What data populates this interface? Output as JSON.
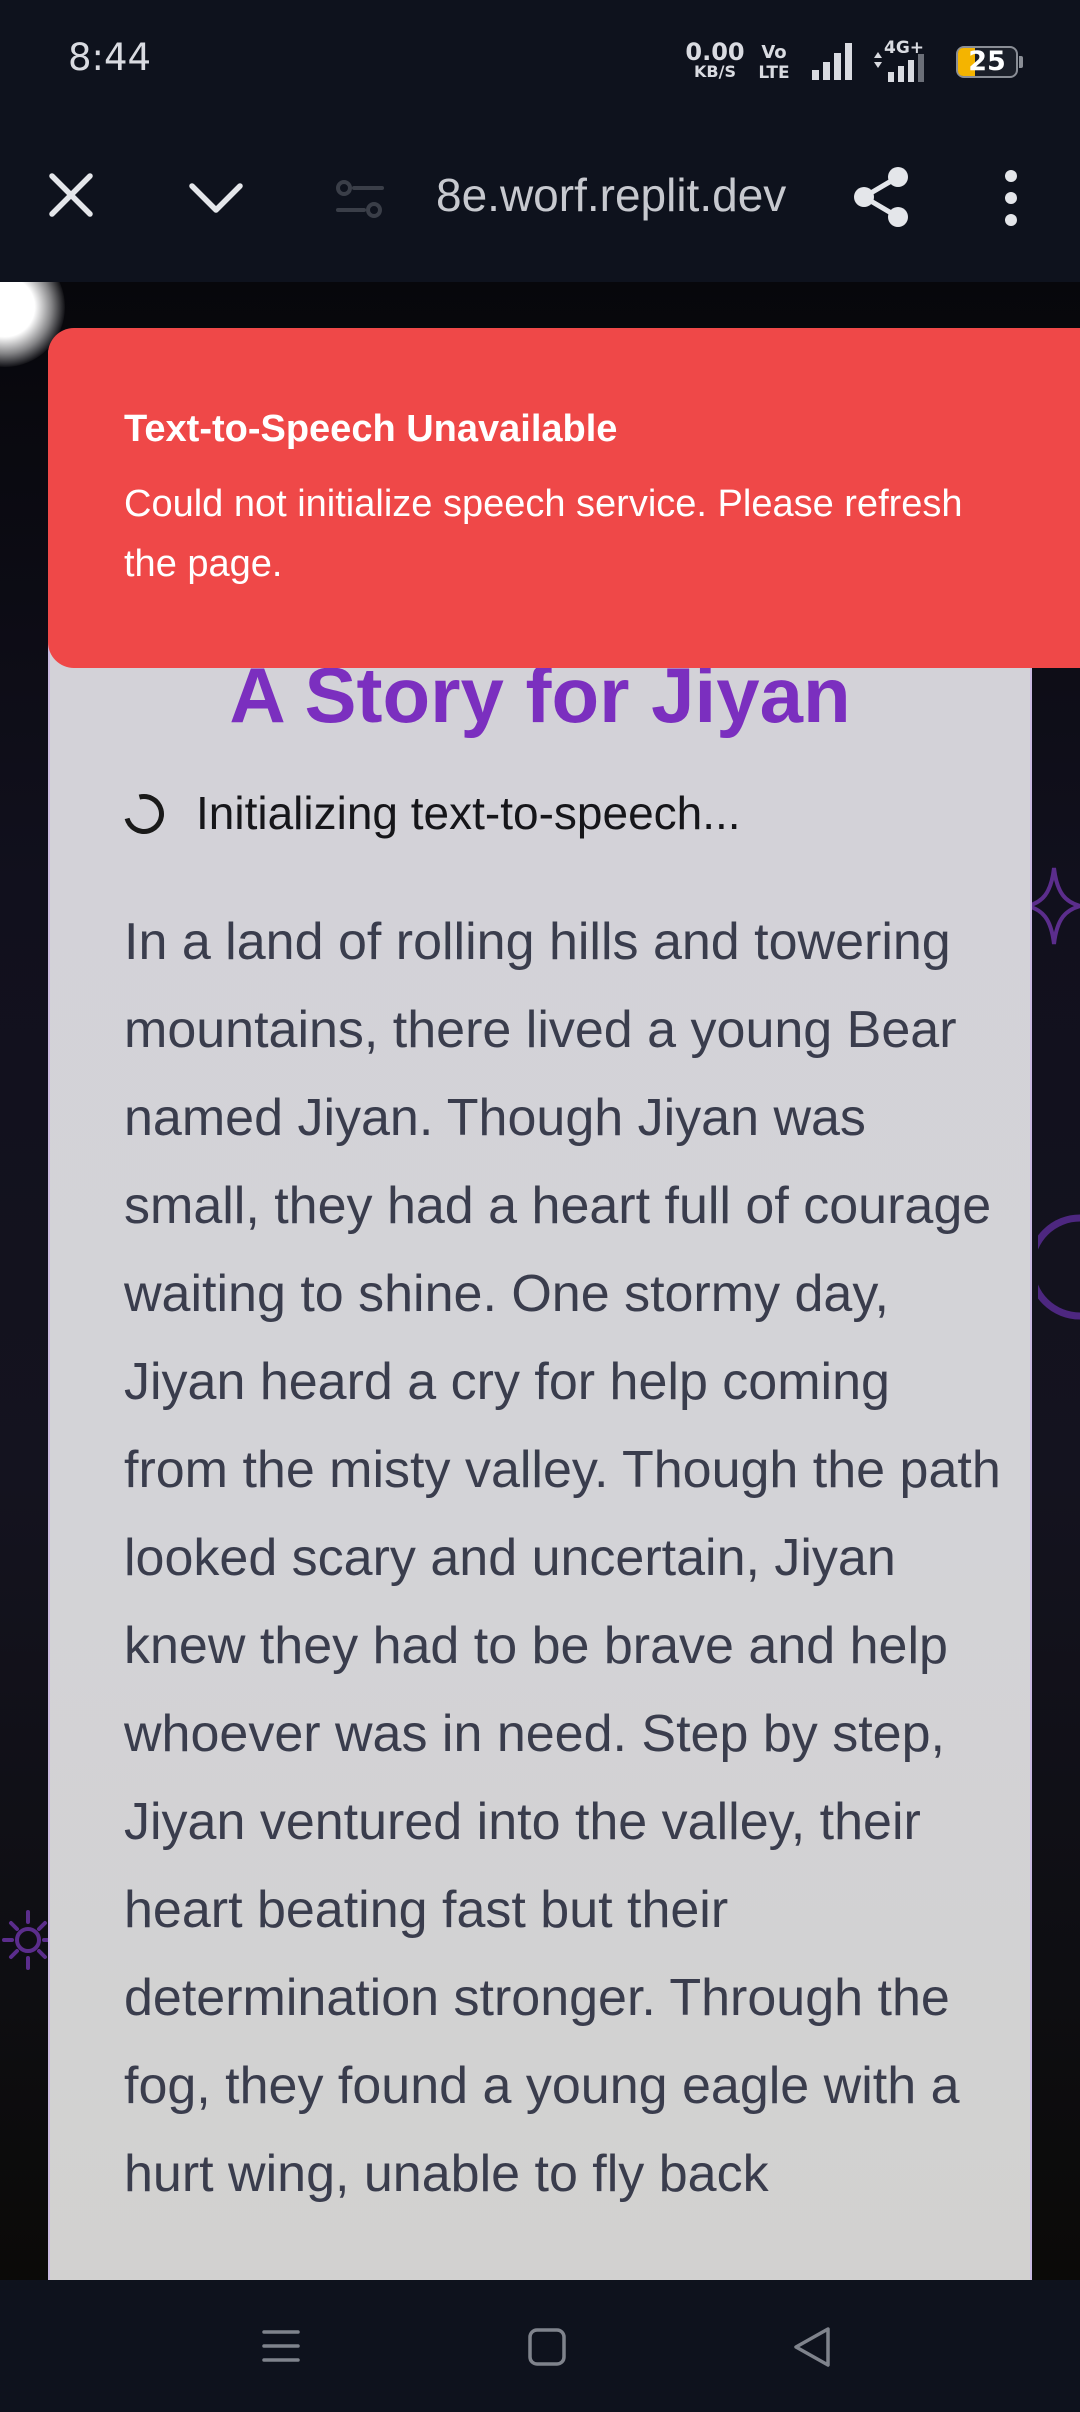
{
  "status_bar": {
    "time": "8:44",
    "net_speed_value": "0.00",
    "net_speed_unit": "KB/S",
    "volte_line1": "Vo",
    "volte_line2": "LTE",
    "network_type": "4G+",
    "battery_level": "25"
  },
  "browser": {
    "url": "8e.worf.replit.dev",
    "icons": [
      "close-icon",
      "chevron-down-icon",
      "page-settings-icon",
      "share-icon",
      "more-vert-icon"
    ]
  },
  "toast": {
    "title": "Text-to-Speech Unavailable",
    "message": "Could not initialize speech service. Please refresh the page."
  },
  "story": {
    "title": "A Story for Jiyan",
    "loading_text": "Initializing text-to-speech...",
    "body": "In a land of rolling hills and towering mountains, there lived a young Bear named Jiyan. Though Jiyan was small, they had a heart full of courage waiting to shine. One stormy day, Jiyan heard a cry for help coming from the misty valley. Though the path looked scary and uncertain, Jiyan knew they had to be brave and help whoever was in need. Step by step, Jiyan ventured into the valley, their heart beating fast but their determination stronger. Through the fog, they found a young eagle with a hurt wing, unable to fly back"
  },
  "colors": {
    "toast_bg": "#ef4848",
    "title_purple": "#7b2fbf",
    "card_bg": "#d3d2d8",
    "chrome_bg": "#0e121d"
  },
  "nav_bar": {
    "icons": [
      "menu-icon",
      "home-icon",
      "back-icon"
    ]
  }
}
